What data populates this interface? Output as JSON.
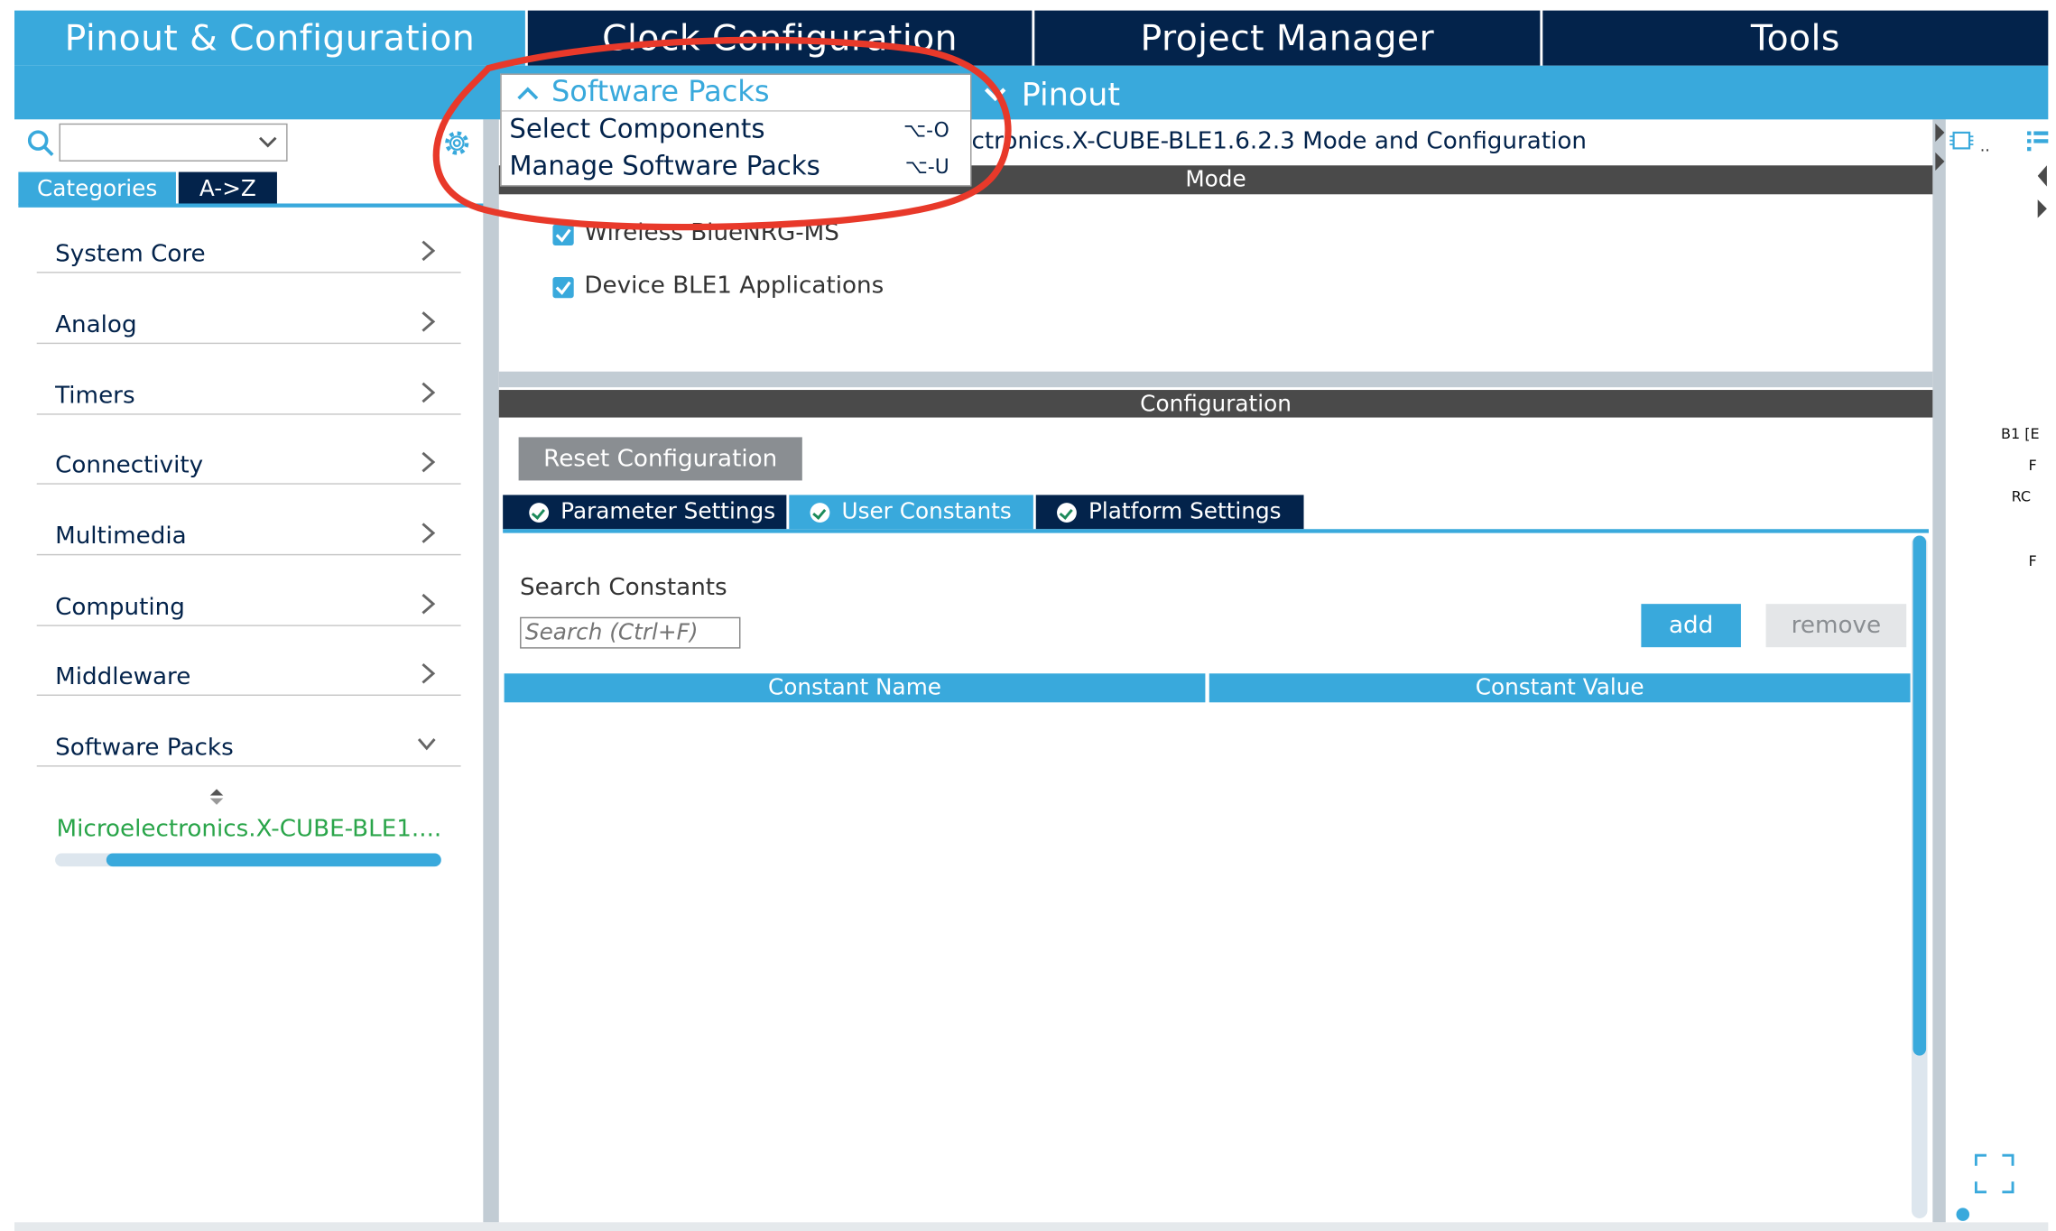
{
  "top_tabs": {
    "pinout": "Pinout & Configuration",
    "clock": "Clock Configuration",
    "project": "Project Manager",
    "tools": "Tools"
  },
  "subbar": {
    "pinout_menu": "Pinout"
  },
  "left_panel": {
    "tab_categories": "Categories",
    "tab_az": "A->Z",
    "items": [
      {
        "label": "System Core"
      },
      {
        "label": "Analog"
      },
      {
        "label": "Timers"
      },
      {
        "label": "Connectivity"
      },
      {
        "label": "Multimedia"
      },
      {
        "label": "Computing"
      },
      {
        "label": "Middleware"
      },
      {
        "label": "Software Packs"
      }
    ],
    "pack_entry": "Microelectronics.X-CUBE-BLE1...."
  },
  "dropdown": {
    "header": "Software Packs",
    "items": [
      {
        "label": "Select Components",
        "shortcut": "⌥-O"
      },
      {
        "label": "Manage Software Packs",
        "shortcut": "⌥-U"
      }
    ]
  },
  "main": {
    "title": "ctronics.X-CUBE-BLE1.6.2.3 Mode and Configuration",
    "mode_header": "Mode",
    "mode_checks": [
      {
        "label": "Wireless BlueNRG-MS",
        "checked": true
      },
      {
        "label": "Device BLE1 Applications",
        "checked": true
      }
    ],
    "config_header": "Configuration",
    "reset_button": "Reset Configuration",
    "tabs": [
      {
        "label": "Parameter Settings"
      },
      {
        "label": "User Constants"
      },
      {
        "label": "Platform Settings"
      }
    ],
    "search_label": "Search Constants",
    "search_placeholder": "Search (Ctrl+F)",
    "add_button": "add",
    "remove_button": "remove",
    "table_headers": [
      "Constant Name",
      "Constant Value"
    ]
  },
  "right_panel": {
    "pin_labels": [
      "B1 [E",
      "F",
      "RC",
      "F"
    ]
  },
  "colors": {
    "accent": "#39a9dc",
    "dark_navy": "#03234b",
    "dark_gray": "#4a4a4a",
    "annotation_red": "#e8392a",
    "pack_green": "#2aa54a"
  }
}
